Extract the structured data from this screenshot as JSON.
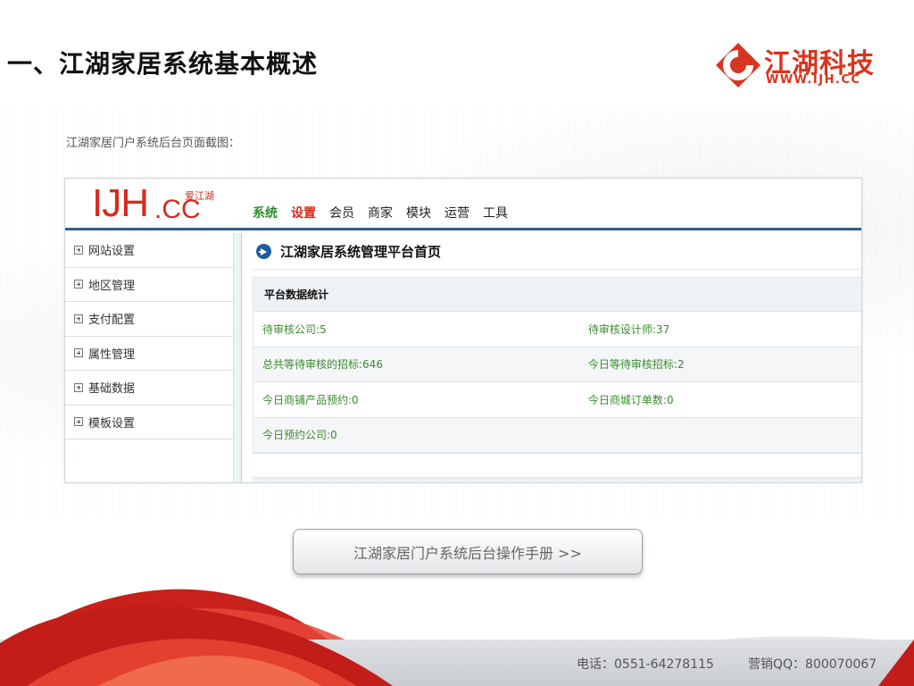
{
  "slide": {
    "title": "一、江湖家居系统基本概述",
    "caption": "江湖家居门户系统后台页面截图："
  },
  "brand": {
    "name": "江湖科技",
    "url": "WWW.IJH.CC",
    "color": "#d9341f"
  },
  "screenshot": {
    "logo_main": "IJH",
    "logo_cc": ".CC",
    "logo_small": "爱江湖",
    "nav": [
      "系统",
      "设置",
      "会员",
      "商家",
      "模块",
      "运营",
      "工具"
    ],
    "sidebar": [
      "网站设置",
      "地区管理",
      "支付配置",
      "属性管理",
      "基础数据",
      "模板设置"
    ],
    "content_title": "江湖家居系统管理平台首页",
    "table_header": "平台数据统计",
    "rows": [
      [
        "待审核公司:5",
        "待审核设计师:37"
      ],
      [
        "总共等待审核的招标:646",
        "今日等待审核招标:2"
      ],
      [
        "今日商铺产品预约:0",
        "今日商城订单数:0"
      ],
      [
        "今日预约公司:0",
        ""
      ]
    ],
    "accent_green": "#3b8a2e",
    "accent_red": "#d62b1e",
    "accent_blue": "#1f5d9a"
  },
  "manual_button": "江湖家居门户系统后台操作手册 >>",
  "footer": {
    "phone": "电话：0551-64278115",
    "qq": "营销QQ：800070067"
  }
}
